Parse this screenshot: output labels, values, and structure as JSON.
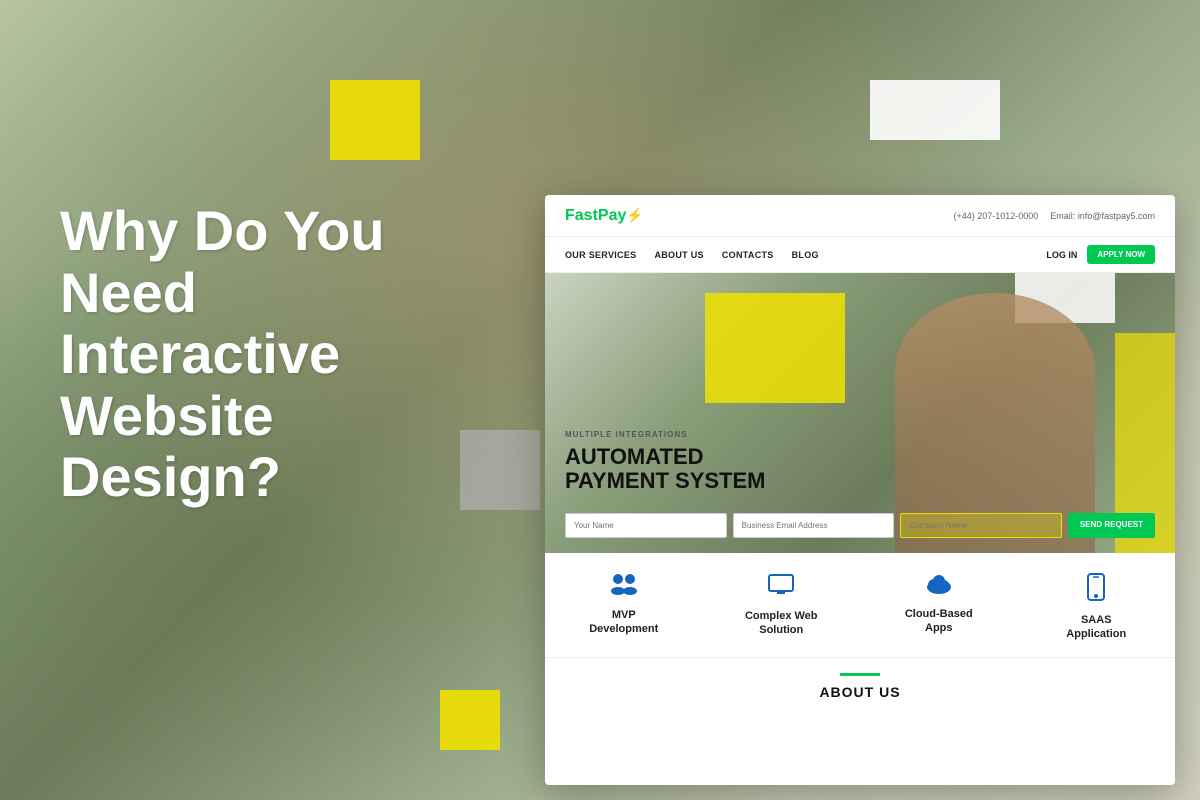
{
  "background": {
    "alt": "Woman working at laptop in office"
  },
  "left_hero": {
    "line1": "Why Do You",
    "line2": "Need",
    "line3": "Interactive",
    "line4": "Website",
    "line5": "Design?"
  },
  "mockup": {
    "logo": {
      "text_fast": "Fast",
      "text_pay": "Pay",
      "icon": "⚡"
    },
    "header": {
      "phone_label": "(+44) 207-1012-0000",
      "email_label": "Email:",
      "email_value": "info@fastpay5.com"
    },
    "nav": {
      "links": [
        {
          "label": "OUR SERVICES"
        },
        {
          "label": "ABOUT US"
        },
        {
          "label": "CONTACTS"
        },
        {
          "label": "BLOG"
        }
      ],
      "login": "LOG IN",
      "apply": "APPLY NOW"
    },
    "hero": {
      "subtitle": "MULTIPLE INTEGRATIONS",
      "title_line1": "AUTOMATED",
      "title_line2": "PAYMENT SYSTEM",
      "form": {
        "name_placeholder": "Your Name",
        "email_placeholder": "Business Email Address",
        "company_placeholder": "Company Name",
        "button_label": "SEND REQUEST"
      }
    },
    "services": [
      {
        "icon": "👥",
        "label": "MVP\nDevelopment",
        "icon_name": "people-icon"
      },
      {
        "icon": "🖥",
        "label": "Complex Web\nSolution",
        "icon_name": "monitor-icon"
      },
      {
        "icon": "☁",
        "label": "Cloud-Based\nApps",
        "icon_name": "cloud-icon"
      },
      {
        "icon": "📱",
        "label": "SAAS\nApplication",
        "icon_name": "mobile-icon"
      }
    ],
    "about": {
      "title": "ABOUT US"
    }
  }
}
